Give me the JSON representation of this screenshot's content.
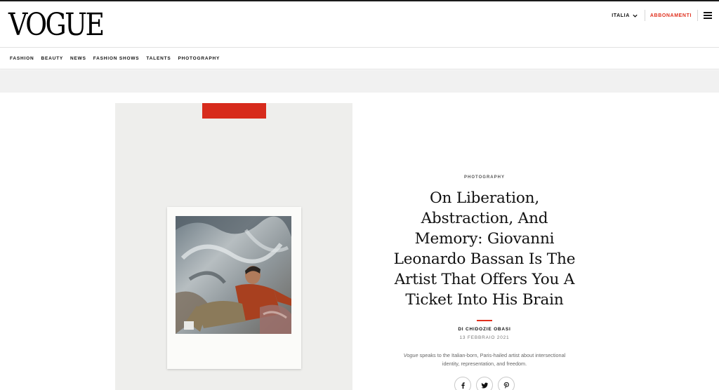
{
  "header": {
    "logo": "VOGUE",
    "edition_label": "ITALIA",
    "subscribe_label": "ABBONAMENTI",
    "menu_icon": "hamburger-menu-icon",
    "accent_color": "#e0301e"
  },
  "nav": {
    "items": [
      {
        "label": "FASHION"
      },
      {
        "label": "BEAUTY"
      },
      {
        "label": "NEWS"
      },
      {
        "label": "FASHION SHOWS"
      },
      {
        "label": "TALENTS"
      },
      {
        "label": "PHOTOGRAPHY"
      }
    ]
  },
  "article": {
    "kicker": "PHOTOGRAPHY",
    "headline_lines": [
      "On Liberation,",
      "Abstraction, And",
      "Memory: Giovanni",
      "Leonardo Bassan Is The",
      "Artist That Offers You A",
      "Ticket Into His Brain"
    ],
    "byline": "DI CHIDOZIE OBASI",
    "date": "13 FEBBRAIO 2021",
    "dek_publication": "Vogue",
    "dek_line1": " speaks to the Italian-born, Paris-hailed artist about intersectional",
    "dek_line2": "identity, representation, and freedom.",
    "share": [
      {
        "icon": "facebook-icon"
      },
      {
        "icon": "twitter-icon"
      },
      {
        "icon": "pinterest-icon"
      }
    ]
  },
  "hero": {
    "tape_color": "#d72b1c"
  }
}
